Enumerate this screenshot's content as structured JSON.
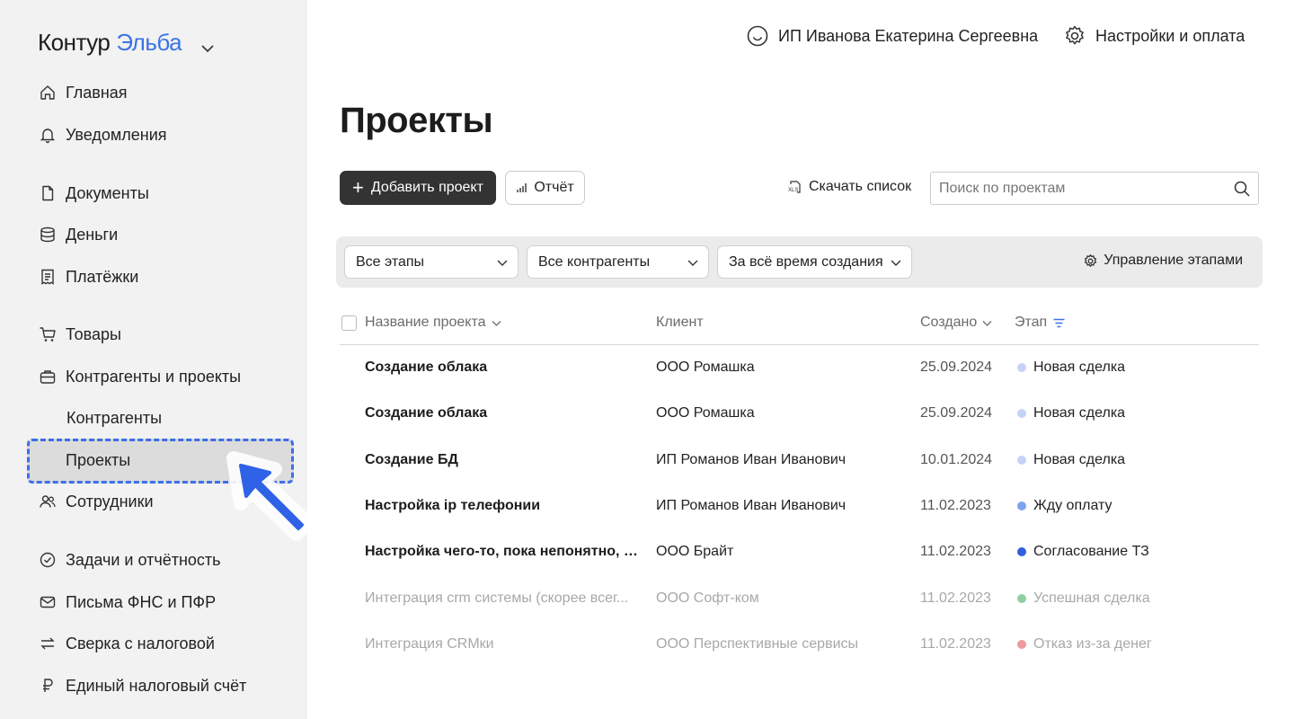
{
  "brand": {
    "part1": "Контур",
    "part2": "Эльба"
  },
  "sidebar": {
    "items": [
      {
        "label": "Главная",
        "icon": "home-icon"
      },
      {
        "label": "Уведомления",
        "icon": "bell-icon"
      },
      {
        "label": "Документы",
        "icon": "document-icon"
      },
      {
        "label": "Деньги",
        "icon": "coins-icon"
      },
      {
        "label": "Платёжки",
        "icon": "receipt-icon"
      },
      {
        "label": "Товары",
        "icon": "cart-icon"
      },
      {
        "label": "Контрагенты и проекты",
        "icon": "briefcase-icon"
      },
      {
        "label": "Контрагенты"
      },
      {
        "label": "Проекты",
        "active": true
      },
      {
        "label": "Сотрудники",
        "icon": "users-icon"
      },
      {
        "label": "Задачи и отчётность",
        "icon": "check-circle-icon"
      },
      {
        "label": "Письма ФНС и ПФР",
        "icon": "mail-icon"
      },
      {
        "label": "Сверка с налоговой",
        "icon": "swap-icon"
      },
      {
        "label": "Единый налоговый счёт",
        "icon": "ruble-icon"
      }
    ]
  },
  "header": {
    "user": "ИП Иванова Екатерина Сергеевна",
    "settings": "Настройки и оплата"
  },
  "page": {
    "title": "Проекты"
  },
  "toolbar": {
    "add_label": "Добавить проект",
    "report_label": "Отчёт",
    "download_label": "Скачать список",
    "search_placeholder": "Поиск по проектам"
  },
  "filters": {
    "stage": "Все этапы",
    "contractor": "Все контрагенты",
    "period": "За всё время создания",
    "manage_label": "Управление этапами"
  },
  "table": {
    "columns": {
      "name": "Название проекта",
      "client": "Клиент",
      "created": "Создано",
      "stage": "Этап"
    },
    "rows": [
      {
        "name": "Создание облака",
        "client": "ООО Ромашка",
        "created": "25.09.2024",
        "stage": "Новая сделка",
        "dot": "#c5d3f7",
        "muted": false
      },
      {
        "name": "Создание облака",
        "client": "ООО Ромашка",
        "created": "25.09.2024",
        "stage": "Новая сделка",
        "dot": "#c5d3f7",
        "muted": false
      },
      {
        "name": "Создание БД",
        "client": "ИП Романов Иван Иванович",
        "created": "10.01.2024",
        "stage": "Новая сделка",
        "dot": "#c5d3f7",
        "muted": false
      },
      {
        "name": "Настройка ip телефонии",
        "client": "ИП Романов Иван Иванович",
        "created": "11.02.2023",
        "stage": "Жду оплату",
        "dot": "#7fa2ef",
        "muted": false
      },
      {
        "name": "Настройка чего-то, пока непонятно, на...",
        "client": "ООО Брайт",
        "created": "11.02.2023",
        "stage": "Согласование ТЗ",
        "dot": "#2f5fe0",
        "muted": false
      },
      {
        "name": "Интеграция crm системы (скорее всег...",
        "client": "ООО Софт-ком",
        "created": "11.02.2023",
        "stage": "Успешная сделка",
        "dot": "#8fcf9f",
        "muted": true
      },
      {
        "name": "Интеграция CRMки",
        "client": "ООО Перспективные сервисы",
        "created": "11.02.2023",
        "stage": "Отказ из-за денег",
        "dot": "#ef9a9a",
        "muted": true
      }
    ]
  },
  "colors": {
    "accent": "#3b73e8",
    "active_outline": "#3b6fe8"
  }
}
